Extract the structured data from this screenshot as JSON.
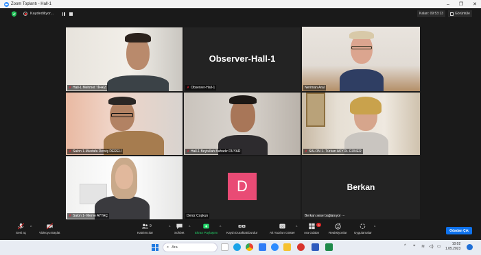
{
  "window": {
    "title": "Zoom Toplantı - Hall-1",
    "minimize": "–",
    "maximize": "❐",
    "close": "✕"
  },
  "topbar": {
    "recording_label": "Kaydediliyor...",
    "timer": "Kalan: 09:53:13",
    "view_label": "Görüntüle"
  },
  "tiles": [
    {
      "name": "Hall-1 Mehmet TİFAİZ",
      "muted": true,
      "active": false
    },
    {
      "name": "Observer-Hall-1",
      "display_name": "Observer-Hall-1",
      "muted": true,
      "active": false
    },
    {
      "name": "Neriman Aral",
      "muted": false,
      "active": true
    },
    {
      "name": "Salon 1-Mustafa Derviş DERELİ",
      "muted": true,
      "active": false
    },
    {
      "name": "Hall-1 Beytullah Bahadır DUYAR",
      "muted": true,
      "active": false
    },
    {
      "name": "SALON 1- Türkan AKYOL GÜNER",
      "muted": true,
      "active": false
    },
    {
      "name": "Salon 1- Merve AYTAÇ",
      "muted": true,
      "active": false
    },
    {
      "name": "Deniz Coşkun",
      "avatar_letter": "D",
      "muted": false,
      "active": false
    },
    {
      "name": "Berkan sese bağlanıyor ⋯",
      "display_name": "Berkan",
      "muted": false,
      "active": false
    }
  ],
  "toolbar": {
    "mute": "Sesi aç",
    "video": "Videoyu Başlat",
    "participants": "Katılımcılar",
    "participants_count": "9",
    "chat": "Sohbet",
    "share": "Ekran Paylaşımı",
    "record": "Kaydı Duraklat/Durdur",
    "captions": "Alt Yazıları Göster",
    "breakout": "Ara Odalar",
    "breakout_badge": "3",
    "reactions": "Reaksiyonlar",
    "apps": "Uygulamalar",
    "leave": "Odadan Çık"
  },
  "taskbar": {
    "search_placeholder": "Ara",
    "time": "10:02",
    "date": "1.05.2023"
  },
  "colors": {
    "accent": "#0e72ed",
    "active_speaker": "#a6e23a",
    "share_green": "#23d96b",
    "avatar_bg": "#e94b75"
  }
}
